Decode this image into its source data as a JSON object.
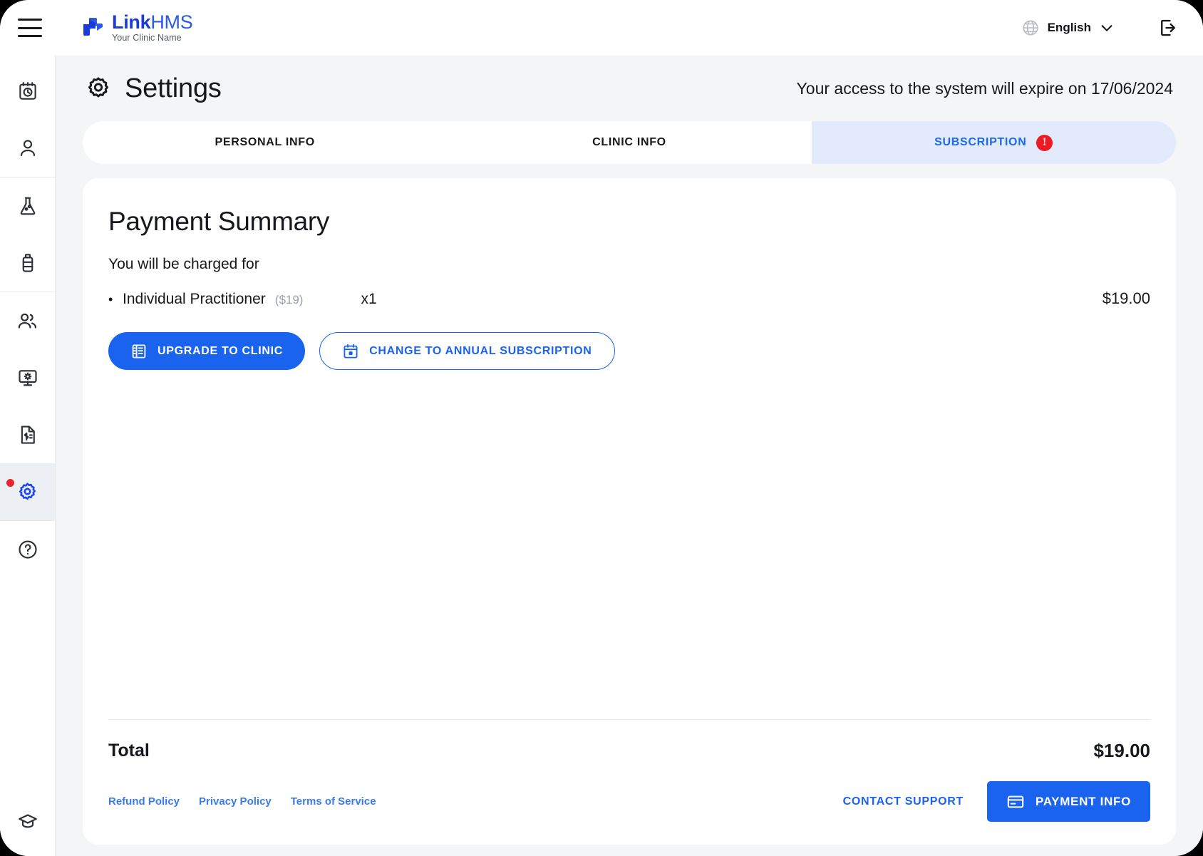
{
  "brand": {
    "name_link": "Link",
    "name_hms": "HMS",
    "tagline": "Your Clinic Name",
    "logo_icon": "medical-cross-icon",
    "color_primary": "#1a3bd6",
    "color_secondary": "#2b59e8"
  },
  "topbar": {
    "menu_icon": "hamburger-menu-icon",
    "language_icon": "globe-icon",
    "language": "English",
    "language_chevron": "chevron-down-icon",
    "logout_icon": "logout-icon"
  },
  "sidebar": {
    "items": [
      {
        "icon": "calendar-clock-icon",
        "name": "appointments",
        "active": false,
        "badge": false
      },
      {
        "icon": "user-icon",
        "name": "patients",
        "active": false,
        "badge": false
      },
      {
        "icon": "lab-flask-icon",
        "name": "laboratory",
        "active": false,
        "badge": false
      },
      {
        "icon": "medicine-bottle-icon",
        "name": "pharmacy",
        "active": false,
        "badge": false
      },
      {
        "icon": "users-group-icon",
        "name": "staff",
        "active": false,
        "badge": false
      },
      {
        "icon": "monitor-gear-icon",
        "name": "workstation",
        "active": false,
        "badge": false
      },
      {
        "icon": "invoice-dollar-icon",
        "name": "billing",
        "active": false,
        "badge": false
      },
      {
        "icon": "gear-icon",
        "name": "settings",
        "active": true,
        "badge": true
      },
      {
        "icon": "help-circle-icon",
        "name": "help",
        "active": false,
        "badge": false
      }
    ],
    "bottom_item": {
      "icon": "graduation-cap-icon",
      "name": "academy"
    },
    "badge_color": "#e8262c",
    "active_color": "#1a47ef"
  },
  "page": {
    "icon": "gear-icon",
    "title": "Settings",
    "expire_notice": "Your access to the system will expire on 17/06/2024"
  },
  "tabs": [
    {
      "label": "PERSONAL INFO",
      "active": false,
      "alert": false
    },
    {
      "label": "CLINIC INFO",
      "active": false,
      "alert": false
    },
    {
      "label": "SUBSCRIPTION",
      "active": true,
      "alert": true,
      "alert_glyph": "!",
      "alert_color": "#ef1b24"
    }
  ],
  "payment_summary": {
    "title": "Payment Summary",
    "charged_label": "You will be charged for",
    "items": [
      {
        "bullet": "•",
        "name": "Individual Practitioner",
        "unit_price": "($19)",
        "quantity": "x1",
        "amount": "$19.00"
      }
    ],
    "actions": [
      {
        "label": "UPGRADE TO CLINIC",
        "icon": "building-icon",
        "style": "primary"
      },
      {
        "label": "CHANGE TO ANNUAL SUBSCRIPTION",
        "icon": "calendar-icon",
        "style": "outline"
      }
    ],
    "total_label": "Total",
    "total_value": "$19.00"
  },
  "footer": {
    "legal_links": [
      {
        "label": "Refund Policy"
      },
      {
        "label": "Privacy Policy"
      },
      {
        "label": "Terms of Service"
      }
    ],
    "support_label": "CONTACT SUPPORT",
    "payment_button": {
      "label": "PAYMENT INFO",
      "icon": "credit-card-icon"
    },
    "accent_color": "#1a63ef"
  }
}
